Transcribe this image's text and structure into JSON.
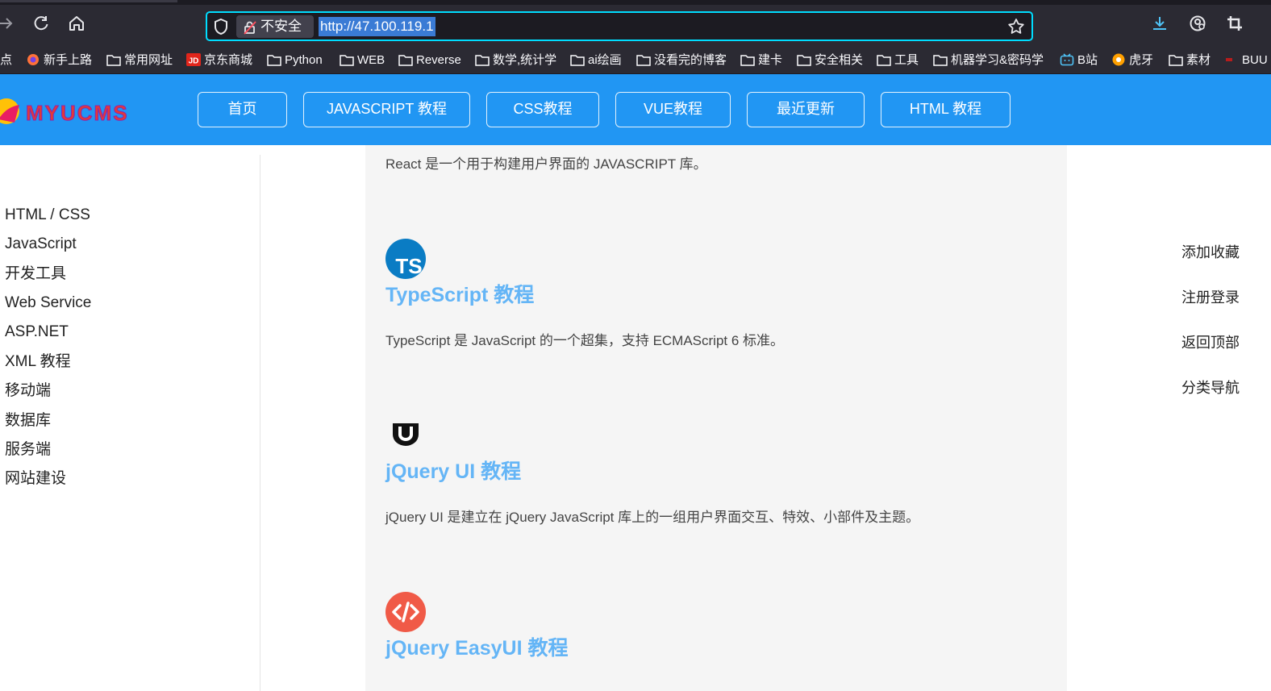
{
  "browser": {
    "insecure_label": "不安全",
    "url": "http://47.100.119.1",
    "bookmarks": [
      {
        "label": "点",
        "icon": "none"
      },
      {
        "label": "新手上路",
        "icon": "firefox-icon"
      },
      {
        "label": "常用网址",
        "icon": "folder-icon"
      },
      {
        "label": "京东商城",
        "icon": "jd-icon"
      },
      {
        "label": "Python",
        "icon": "folder-icon"
      },
      {
        "label": "WEB",
        "icon": "folder-icon"
      },
      {
        "label": "Reverse",
        "icon": "folder-icon"
      },
      {
        "label": "数学,统计学",
        "icon": "folder-icon"
      },
      {
        "label": "ai绘画",
        "icon": "folder-icon"
      },
      {
        "label": "没看完的博客",
        "icon": "folder-icon"
      },
      {
        "label": "建卡",
        "icon": "folder-icon"
      },
      {
        "label": "安全相关",
        "icon": "folder-icon"
      },
      {
        "label": "工具",
        "icon": "folder-icon"
      },
      {
        "label": "机器学习&密码学",
        "icon": "folder-icon"
      },
      {
        "label": "B站",
        "icon": "bilibili-icon"
      },
      {
        "label": "虎牙",
        "icon": "huya-icon"
      },
      {
        "label": "素材",
        "icon": "folder-icon"
      },
      {
        "label": "BUU",
        "icon": "buu-icon"
      }
    ]
  },
  "header": {
    "logo_text": "MYUCMS",
    "nav": [
      "首页",
      "JAVASCRIPT 教程",
      "CSS教程",
      "VUE教程",
      "最近更新",
      "HTML 教程"
    ]
  },
  "sidebar": {
    "items": [
      "HTML / CSS",
      "JavaScript",
      "开发工具",
      "Web Service",
      "ASP.NET",
      "XML 教程",
      "移动端",
      "数据库",
      "服务端",
      "网站建设"
    ]
  },
  "main": {
    "top_desc": "React 是一个用于构建用户界面的 JAVASCRIPT 库。",
    "courses": [
      {
        "title": "TypeScript 教程",
        "desc": "TypeScript 是 JavaScript 的一个超集，支持 ECMAScript 6 标准。",
        "icon": "typescript-icon",
        "icon_text": "TS"
      },
      {
        "title": "jQuery UI 教程",
        "desc": "jQuery UI 是建立在 jQuery JavaScript 库上的一组用户界面交互、特效、小部件及主题。",
        "icon": "jquery-ui-icon"
      },
      {
        "title": "jQuery EasyUI 教程",
        "desc": "",
        "icon": "code-icon"
      }
    ]
  },
  "right_links": [
    "添加收藏",
    "注册登录",
    "返回顶部",
    "分类导航"
  ],
  "colors": {
    "header_bg": "#2196f3",
    "title_blue": "#64b5f6",
    "browser_bg": "#2b2a33",
    "url_focus": "#00ddff",
    "ts_blue": "#0a7cc4",
    "code_red": "#f05a47"
  }
}
